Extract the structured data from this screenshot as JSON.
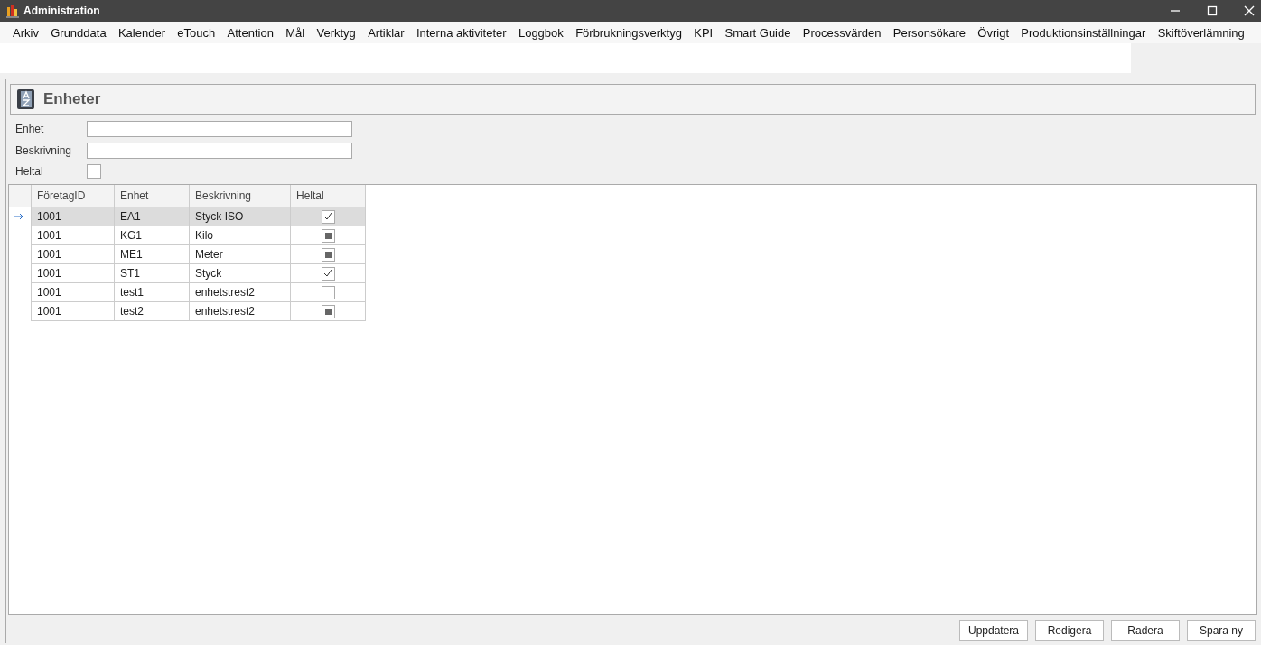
{
  "window": {
    "title": "Administration"
  },
  "menu": [
    "Arkiv",
    "Grunddata",
    "Kalender",
    "eTouch",
    "Attention",
    "Mål",
    "Verktyg",
    "Artiklar",
    "Interna aktiviteter",
    "Loggbok",
    "Förbrukningsverktyg",
    "KPI",
    "Smart Guide",
    "Processvärden",
    "Personsökare",
    "Övrigt",
    "Produktionsinställningar",
    "Skiftöverlämning"
  ],
  "panel": {
    "title": "Enheter"
  },
  "form": {
    "fields": [
      {
        "label": "Enhet",
        "kind": "text"
      },
      {
        "label": "Beskrivning",
        "kind": "text"
      },
      {
        "label": "Heltal",
        "kind": "checkbox",
        "checked": false
      }
    ]
  },
  "table": {
    "columns": [
      "FöretagID",
      "Enhet",
      "Beskrivning",
      "Heltal"
    ],
    "rows": [
      {
        "selected": true,
        "cells": [
          "1001",
          "EA1",
          "Styck ISO"
        ],
        "checked": true,
        "indeterminate": false
      },
      {
        "selected": false,
        "cells": [
          "1001",
          "KG1",
          "Kilo"
        ],
        "checked": false,
        "indeterminate": true
      },
      {
        "selected": false,
        "cells": [
          "1001",
          "ME1",
          "Meter"
        ],
        "checked": false,
        "indeterminate": true
      },
      {
        "selected": false,
        "cells": [
          "1001",
          "ST1",
          "Styck"
        ],
        "checked": true,
        "indeterminate": false
      },
      {
        "selected": false,
        "cells": [
          "1001",
          "test1",
          "enhetstrest2"
        ],
        "checked": false,
        "indeterminate": false
      },
      {
        "selected": false,
        "cells": [
          "1001",
          "test2",
          "enhetstrest2"
        ],
        "checked": false,
        "indeterminate": true
      }
    ]
  },
  "buttons": [
    "Uppdatera",
    "Redigera",
    "Radera",
    "Spara ny"
  ]
}
